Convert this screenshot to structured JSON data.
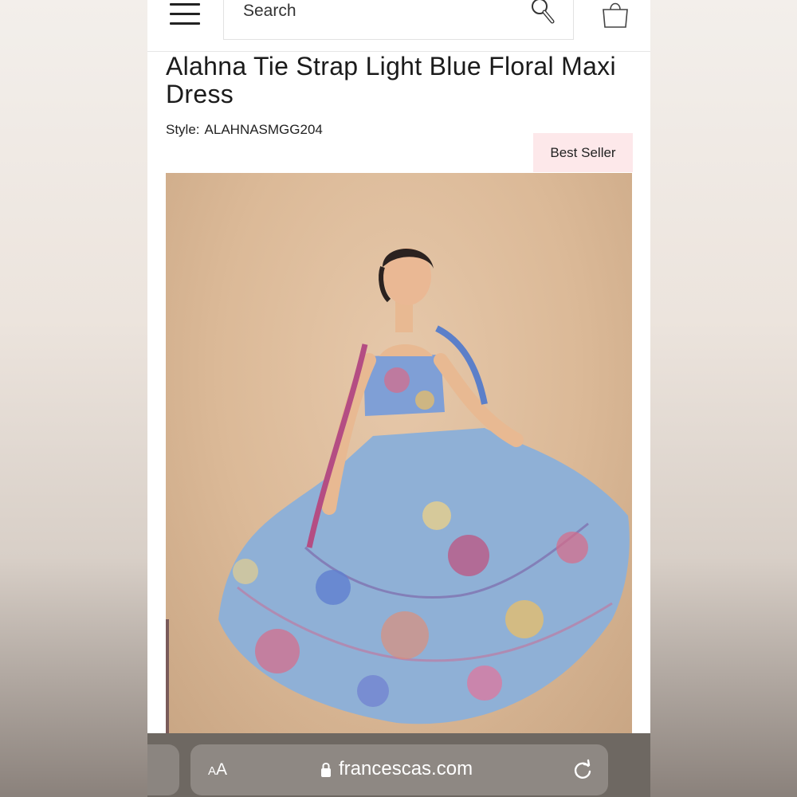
{
  "header": {
    "search_placeholder": "Search"
  },
  "product": {
    "title": "Alahna Tie Strap Light Blue Floral Maxi Dress",
    "style_label": "Style:",
    "style_value": "ALAHNASMGG204",
    "badge": "Best Seller"
  },
  "browser": {
    "text_size_label_small": "A",
    "text_size_label_large": "A",
    "domain": "francescas.com"
  },
  "colors": {
    "badge_bg": "#fde8ea",
    "photo_bg": "#dbb997",
    "browser_bar": "#6e6862"
  },
  "icons": {
    "menu": "hamburger-menu-icon",
    "search": "magnifier-icon",
    "cart": "shopping-bag-icon",
    "lock": "lock-icon",
    "reload": "reload-icon"
  }
}
